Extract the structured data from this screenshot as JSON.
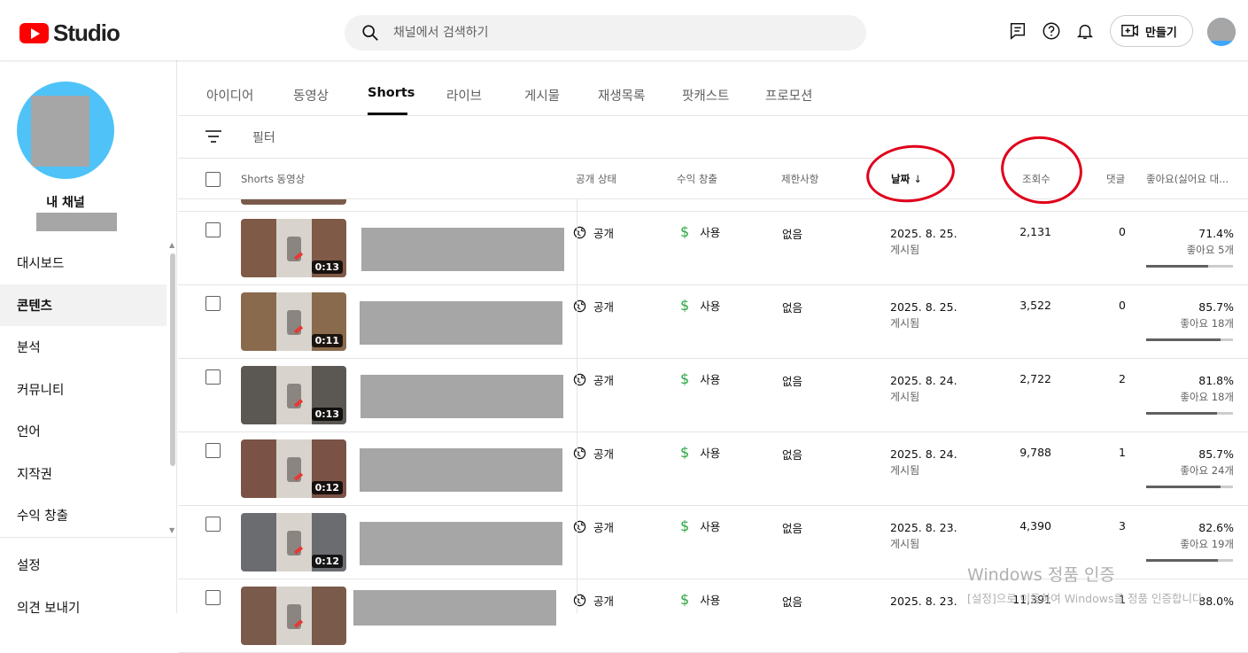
{
  "app": {
    "brand": "Studio"
  },
  "search": {
    "placeholder": "채널에서 검색하기"
  },
  "header": {
    "create_label": "만들기"
  },
  "sidebar": {
    "channel_label": "내 채널",
    "items": [
      {
        "label": "대시보드",
        "active": false
      },
      {
        "label": "콘텐츠",
        "active": true
      },
      {
        "label": "분석",
        "active": false
      },
      {
        "label": "커뮤니티",
        "active": false
      },
      {
        "label": "언어",
        "active": false
      },
      {
        "label": "지작권",
        "active": false
      },
      {
        "label": "수익 창출",
        "active": false
      }
    ],
    "bottom_items": [
      {
        "label": "설정"
      },
      {
        "label": "의견 보내기"
      }
    ]
  },
  "tabs": [
    "아이디어",
    "동영상",
    "Shorts",
    "라이브",
    "게시물",
    "재생목록",
    "팟캐스트",
    "프로모션"
  ],
  "active_tab": "Shorts",
  "filter": {
    "placeholder": "필터"
  },
  "table": {
    "columns": {
      "video": "Shorts 동영상",
      "visibility": "공개 상태",
      "monetization": "수익 창출",
      "restrictions": "제한사항",
      "date": "날짜",
      "views": "조회수",
      "comments": "댓글",
      "likes": "좋아요(싫어요 대..."
    },
    "rows": [
      {
        "duration": "0:13",
        "visibility": "공개",
        "monetization": "사용",
        "restrictions": "없음",
        "date": "2025. 8. 25.",
        "date_status": "게시됨",
        "views": "2,131",
        "comments": "0",
        "like_pct": "71.4%",
        "like_count": "좋아요 5개",
        "like_ratio": 0.714
      },
      {
        "duration": "0:11",
        "visibility": "공개",
        "monetization": "사용",
        "restrictions": "없음",
        "date": "2025. 8. 25.",
        "date_status": "게시됨",
        "views": "3,522",
        "comments": "0",
        "like_pct": "85.7%",
        "like_count": "좋아요 18개",
        "like_ratio": 0.857
      },
      {
        "duration": "0:13",
        "visibility": "공개",
        "monetization": "사용",
        "restrictions": "없음",
        "date": "2025. 8. 24.",
        "date_status": "게시됨",
        "views": "2,722",
        "comments": "2",
        "like_pct": "81.8%",
        "like_count": "좋아요 18개",
        "like_ratio": 0.818
      },
      {
        "duration": "0:12",
        "visibility": "공개",
        "monetization": "사용",
        "restrictions": "없음",
        "date": "2025. 8. 24.",
        "date_status": "게시됨",
        "views": "9,788",
        "comments": "1",
        "like_pct": "85.7%",
        "like_count": "좋아요 24개",
        "like_ratio": 0.857
      },
      {
        "duration": "0:12",
        "visibility": "공개",
        "monetization": "사용",
        "restrictions": "없음",
        "date": "2025. 8. 23.",
        "date_status": "게시됨",
        "views": "4,390",
        "comments": "3",
        "like_pct": "82.6%",
        "like_count": "좋아요 19개",
        "like_ratio": 0.826
      },
      {
        "duration": "",
        "visibility": "공개",
        "monetization": "사용",
        "restrictions": "없음",
        "date": "2025. 8. 23.",
        "date_status": "",
        "views": "11,391",
        "comments": "1",
        "like_pct": "88.0%",
        "like_count": "",
        "like_ratio": 0.88
      }
    ]
  },
  "watermark": {
    "line1": "Windows 정품 인증",
    "line2": "[설정]으로 이동하여 Windows를 정품 인증합니다."
  },
  "colors": {
    "accent": "#ff0000",
    "annotation": "#e0001b",
    "monetized": "#2ba640"
  }
}
